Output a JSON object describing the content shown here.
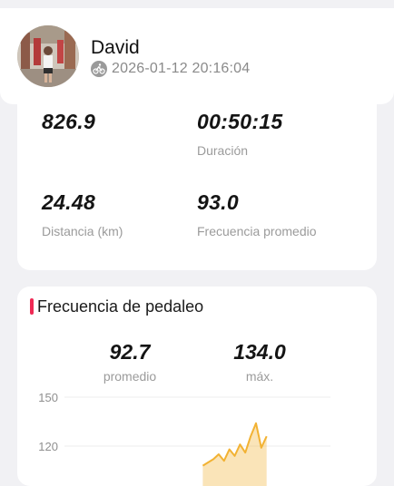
{
  "header": {
    "name": "David",
    "timestamp": "2026-01-12 20:16:04"
  },
  "stats": [
    {
      "value": "826.9",
      "label": ""
    },
    {
      "value": "00:50:15",
      "label": "Duración"
    },
    {
      "value": "24.48",
      "label": "Distancia (km)"
    },
    {
      "value": "93.0",
      "label": "Frecuencia promedio"
    }
  ],
  "cadence": {
    "title": "Frecuencia de pedaleo",
    "avg_value": "92.7",
    "avg_label": "promedio",
    "max_value": "134.0",
    "max_label": "máx."
  },
  "chart_data": {
    "type": "area",
    "yticks": [
      "150",
      "120"
    ],
    "ylim": [
      105,
      150
    ],
    "color": "#f2b233",
    "x": [
      0.52,
      0.54,
      0.56,
      0.58,
      0.6,
      0.62,
      0.64,
      0.66,
      0.68,
      0.7,
      0.72,
      0.74,
      0.76
    ],
    "values": [
      108,
      110,
      112,
      115,
      111,
      118,
      114,
      121,
      116,
      126,
      134,
      119,
      126
    ]
  }
}
